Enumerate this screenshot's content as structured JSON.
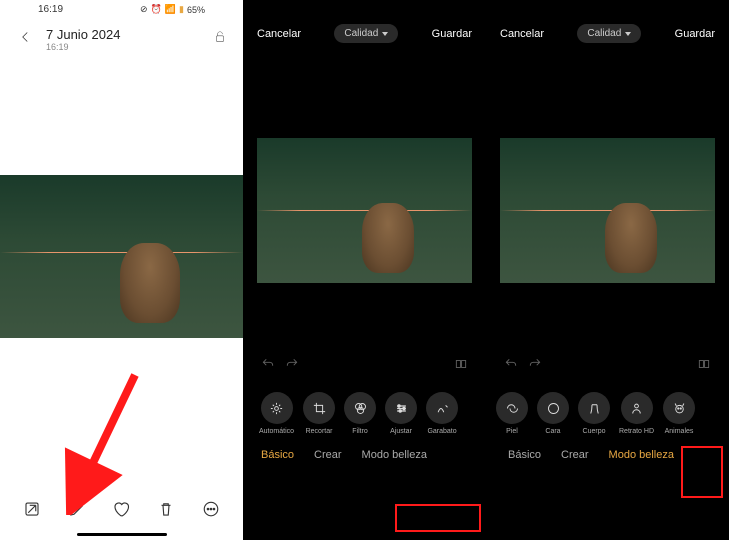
{
  "gallery": {
    "status_time": "16:19",
    "battery": "65%",
    "date": "7 Junio 2024",
    "time": "16:19"
  },
  "editor": {
    "cancel": "Cancelar",
    "quality": "Calidad",
    "save": "Guardar",
    "tabs": {
      "basico": "Básico",
      "crear": "Crear",
      "modo_belleza": "Modo belleza"
    },
    "tools_mid": [
      {
        "id": "automatico",
        "label": "Automático"
      },
      {
        "id": "recortar",
        "label": "Recortar"
      },
      {
        "id": "filtro",
        "label": "Filtro"
      },
      {
        "id": "ajustar",
        "label": "Ajustar"
      },
      {
        "id": "garabato",
        "label": "Garabato"
      }
    ],
    "tools_right": [
      {
        "id": "piel",
        "label": "Piel"
      },
      {
        "id": "cara",
        "label": "Cara"
      },
      {
        "id": "cuerpo",
        "label": "Cuerpo"
      },
      {
        "id": "retrato_hd",
        "label": "Retrato HD"
      },
      {
        "id": "animales",
        "label": "Animales"
      }
    ]
  }
}
